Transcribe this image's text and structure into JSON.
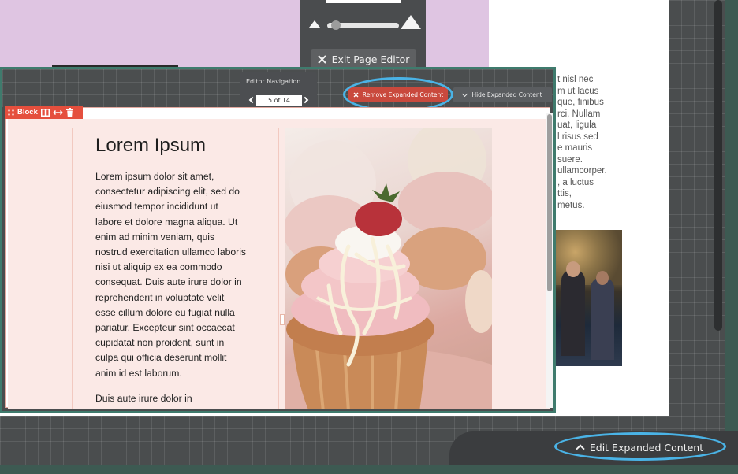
{
  "background_page": {
    "body_text_lines": "t nisl nec\nm ut lacus\nque, finibus\nrci. Nullam\nuat, ligula\nl risus sed\ne mauris\nsuere.\nullamcorper.\n, a luctus\nttis,\nmetus."
  },
  "top_toolbar": {
    "exit_label": "Exit Page Editor",
    "exit_icon": "close-icon"
  },
  "editor_navigation": {
    "title": "Editor Navigation",
    "page_indicator": "5 of 14"
  },
  "expanded_controls": {
    "remove_label": "Remove Expanded Content",
    "hide_label": "Hide Expanded Content"
  },
  "block": {
    "tag_label": "Block",
    "heading": "Lorem Ipsum",
    "paragraph_1": "Lorem ipsum dolor sit amet,\nconsectetur adipiscing elit, sed do\neiusmod tempor incididunt ut\nlabore et dolore magna aliqua. Ut\nenim ad minim veniam, quis\nnostrud exercitation ullamco laboris\nnisi ut aliquip ex ea commodo\nconsequat. Duis aute irure dolor in\nreprehenderit in voluptate velit\nesse cillum dolore eu fugiat nulla\npariatur. Excepteur sint occaecat\ncupidatat non proident, sunt in\nculpa qui officia deserunt mollit\nanim id est laborum.",
    "paragraph_2": "Duis aute irure dolor in"
  },
  "bottom_bar": {
    "edit_label": "Edit Expanded Content"
  },
  "colors": {
    "accent_red": "#e54f3d",
    "highlight_ring": "#4ab3e6",
    "frame_green": "#3f7b6d"
  }
}
